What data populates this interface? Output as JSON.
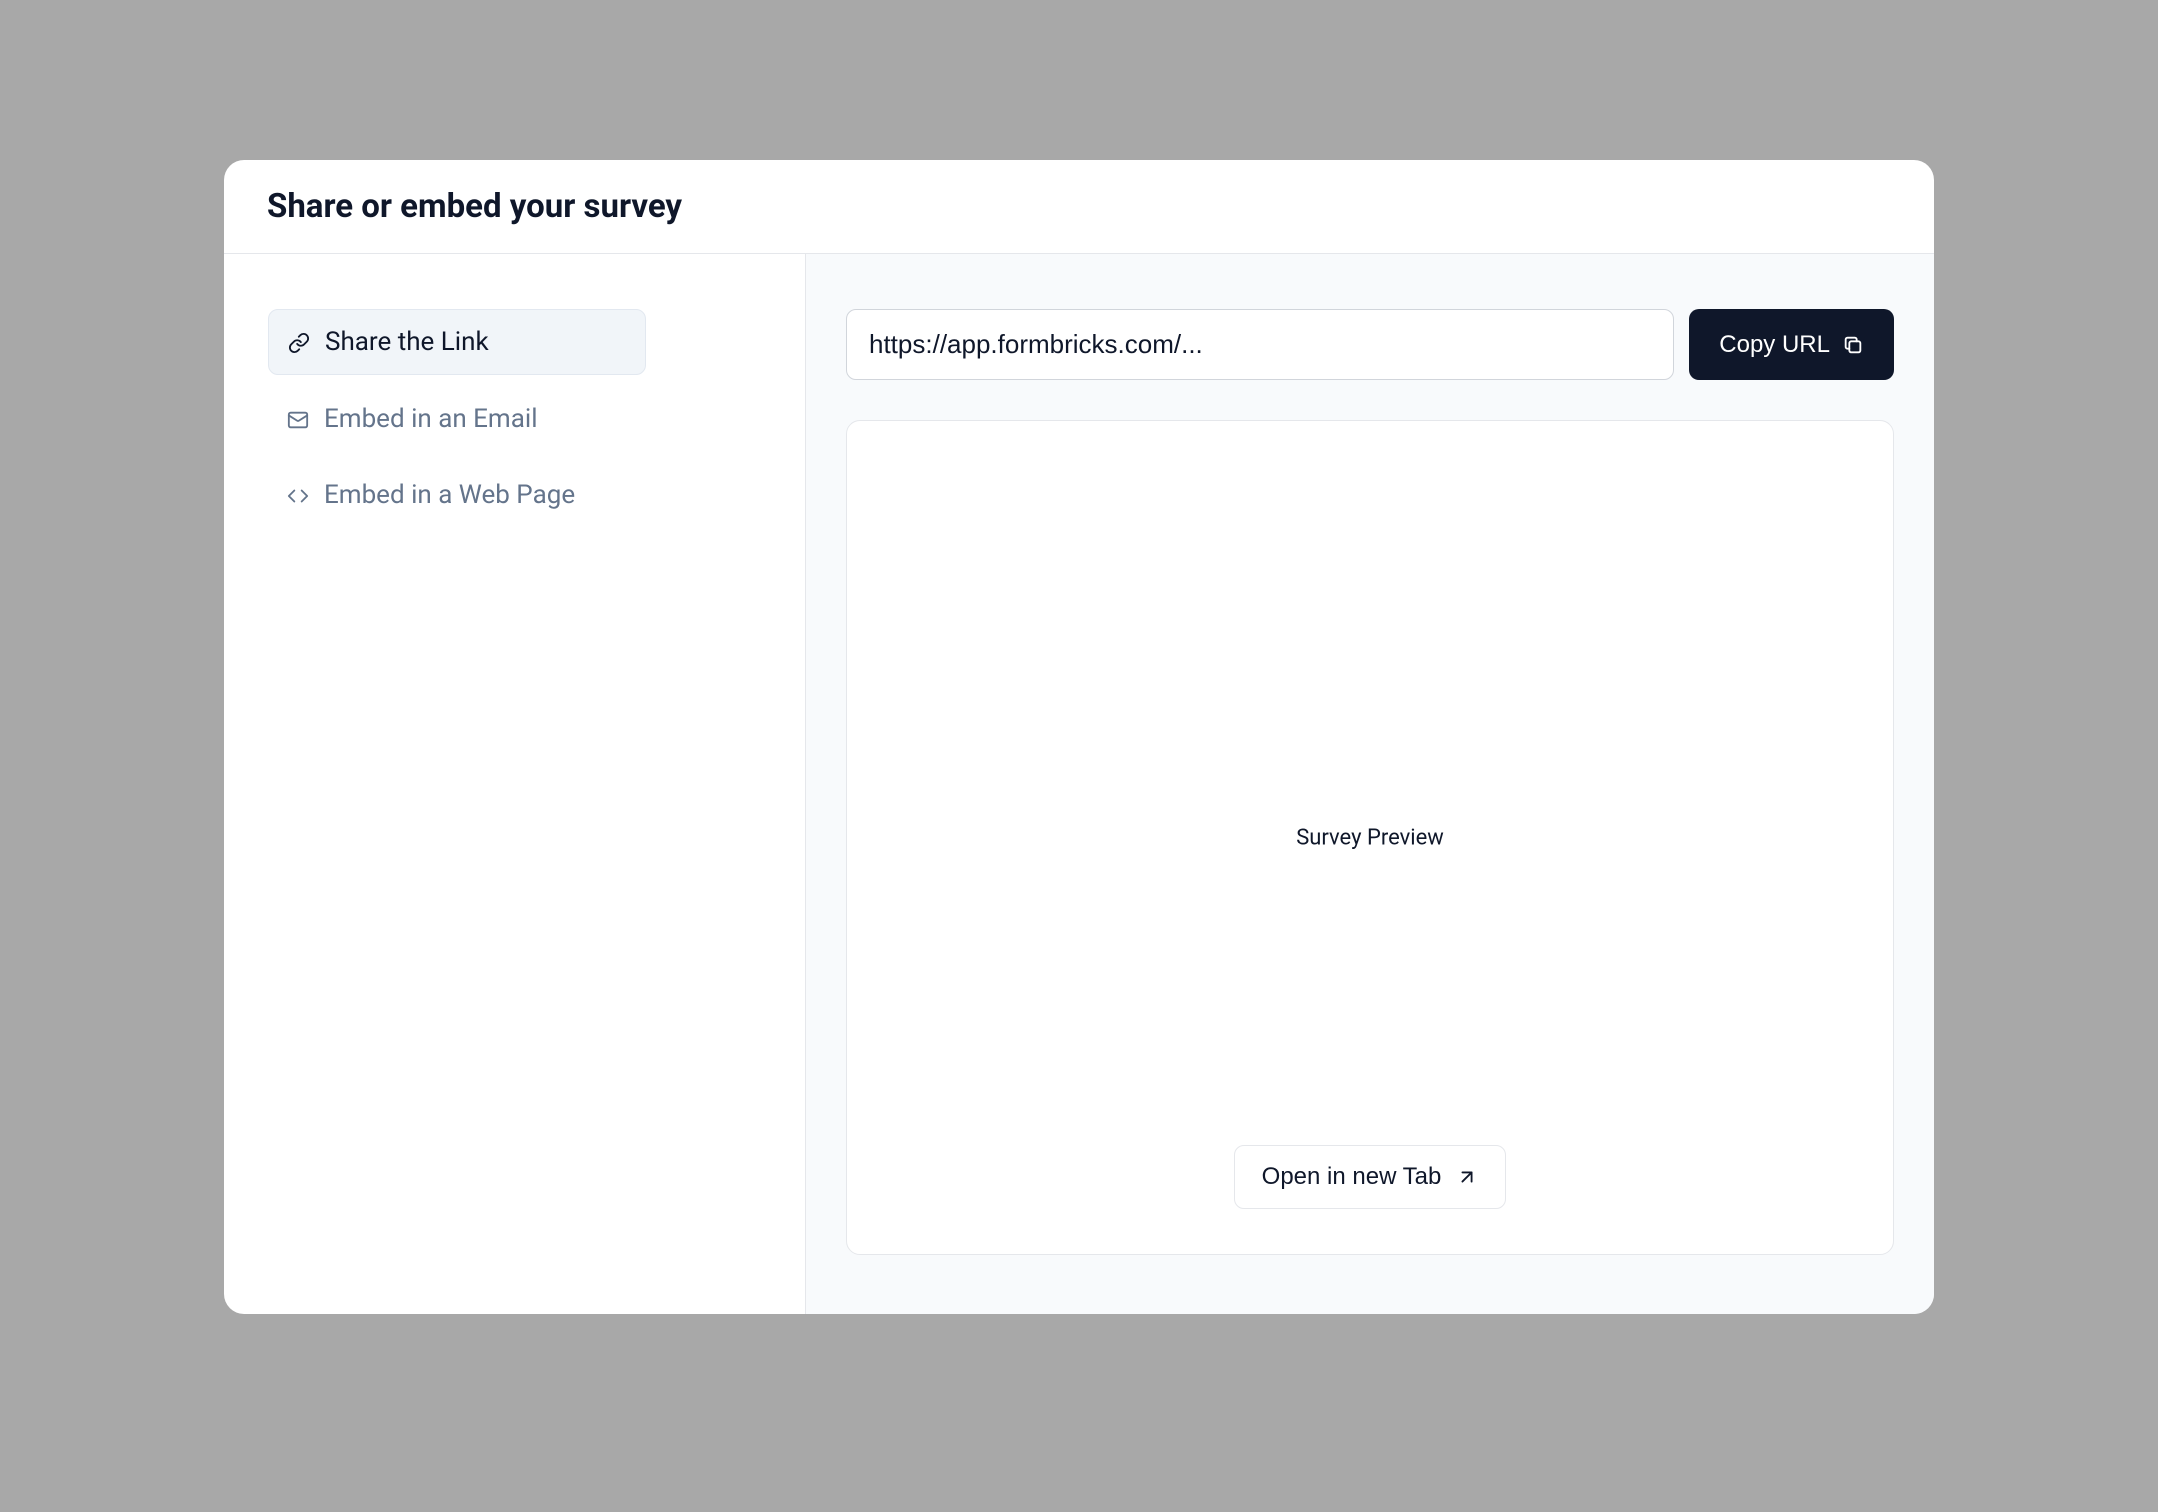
{
  "modal": {
    "title": "Share or embed your survey"
  },
  "sidebar": {
    "items": [
      {
        "label": "Share the Link",
        "active": true
      },
      {
        "label": "Embed in an Email",
        "active": false
      },
      {
        "label": "Embed in a Web Page",
        "active": false
      }
    ]
  },
  "main": {
    "url_value": "https://app.formbricks.com/...",
    "copy_btn_label": "Copy URL",
    "preview_label": "Survey Preview",
    "open_tab_label": "Open in new Tab"
  }
}
